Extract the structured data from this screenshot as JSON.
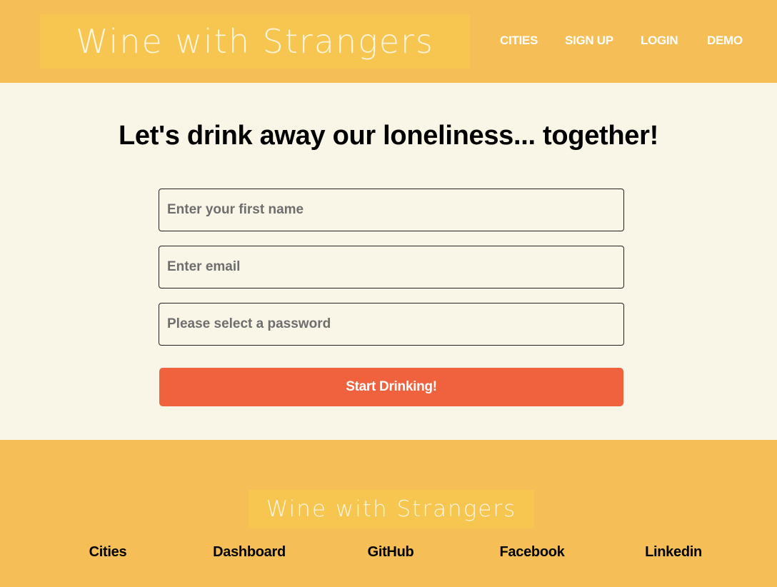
{
  "header": {
    "logo_text": "Wine with Strangers",
    "nav": [
      {
        "label": "CITIES"
      },
      {
        "label": "SIGN UP"
      },
      {
        "label": "LOGIN"
      },
      {
        "label": "DEMO"
      }
    ]
  },
  "main": {
    "headline": "Let's drink away our loneliness... together!",
    "form": {
      "first_name_placeholder": "Enter your first name",
      "email_placeholder": "Enter email",
      "password_placeholder": "Please select a password",
      "submit_label": "Start Drinking!"
    }
  },
  "footer": {
    "logo_text": "Wine with Strangers",
    "links": [
      {
        "label": "Cities"
      },
      {
        "label": "Dashboard"
      },
      {
        "label": "GitHub"
      },
      {
        "label": "Facebook"
      },
      {
        "label": "Linkedin"
      }
    ]
  },
  "colors": {
    "header_bg": "#F5BE56",
    "logo_box_bg": "#F7C651",
    "page_bg": "#F9F5E7",
    "button_bg": "#F0623E",
    "nav_text": "#FFFFFF"
  }
}
